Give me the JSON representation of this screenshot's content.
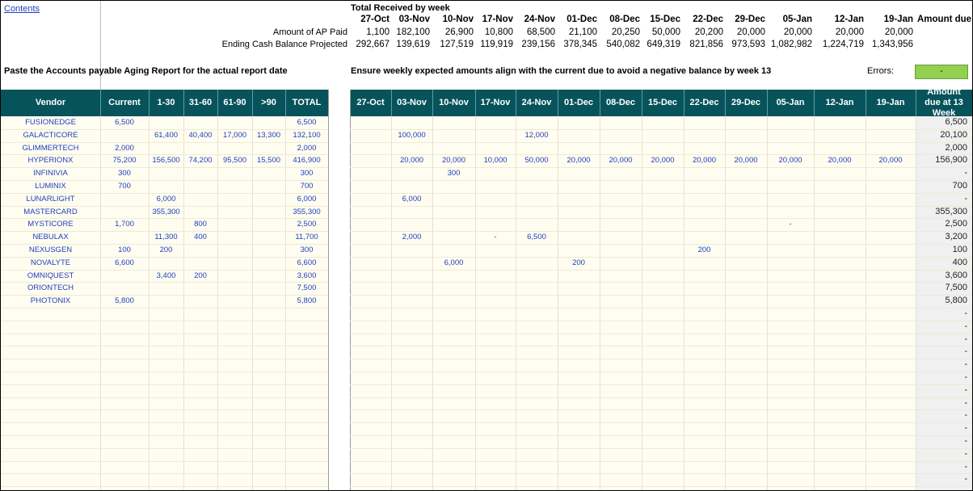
{
  "sheet": {
    "contents_link": "Contents",
    "top_title": "Total Received by week",
    "weeks": [
      "27-Oct",
      "03-Nov",
      "10-Nov",
      "17-Nov",
      "24-Nov",
      "01-Dec",
      "08-Dec",
      "15-Dec",
      "22-Dec",
      "29-Dec",
      "05-Jan",
      "12-Jan",
      "19-Jan"
    ],
    "amount_due_top": "Amount due a",
    "ap_paid_label": "Amount of AP Paid",
    "ap_paid": [
      "1,100",
      "182,100",
      "26,900",
      "10,800",
      "68,500",
      "21,100",
      "20,250",
      "50,000",
      "20,200",
      "20,000",
      "20,000",
      "20,000",
      "20,000"
    ],
    "cash_label": "Ending Cash Balance Projected",
    "cash": [
      "292,667",
      "139,619",
      "127,519",
      "119,919",
      "239,156",
      "378,345",
      "540,082",
      "649,319",
      "821,856",
      "973,593",
      "1,082,982",
      "1,224,719",
      "1,343,956"
    ],
    "instruction_left": "Paste the Accounts payable Aging Report for the actual report date",
    "instruction_right": "Ensure weekly expected amounts align with the current due to avoid a negative balance by week 13",
    "errors_label": "Errors:",
    "errors_value": "-",
    "aging_headers": [
      "Vendor",
      "Current",
      "1-30",
      "31-60",
      "61-90",
      ">90",
      "TOTAL"
    ],
    "due_header": "Amount due at  13 Week",
    "vendors": [
      {
        "name": "FUSIONEDGE",
        "aging": [
          "6,500",
          "",
          "",
          "",
          "",
          "6,500"
        ],
        "weekly": [
          "",
          "",
          "",
          "",
          "",
          "",
          "",
          "",
          "",
          "",
          "",
          "",
          ""
        ],
        "due": "6,500"
      },
      {
        "name": "GALACTICORE",
        "aging": [
          "",
          "61,400",
          "40,400",
          "17,000",
          "13,300",
          "132,100"
        ],
        "weekly": [
          "",
          "100,000",
          "",
          "",
          "12,000",
          "",
          "",
          "",
          "",
          "",
          "",
          "",
          ""
        ],
        "due": "20,100"
      },
      {
        "name": "GLIMMERTECH",
        "aging": [
          "2,000",
          "",
          "",
          "",
          "",
          "2,000"
        ],
        "weekly": [
          "",
          "",
          "",
          "",
          "",
          "",
          "",
          "",
          "",
          "",
          "",
          "",
          ""
        ],
        "due": "2,000"
      },
      {
        "name": "HYPERIONX",
        "aging": [
          "75,200",
          "156,500",
          "74,200",
          "95,500",
          "15,500",
          "416,900"
        ],
        "weekly": [
          "",
          "20,000",
          "20,000",
          "10,000",
          "50,000",
          "20,000",
          "20,000",
          "20,000",
          "20,000",
          "20,000",
          "20,000",
          "20,000",
          "20,000"
        ],
        "due": "156,900"
      },
      {
        "name": "INFINIVIA",
        "aging": [
          "300",
          "",
          "",
          "",
          "",
          "300"
        ],
        "weekly": [
          "",
          "",
          "300",
          "",
          "",
          "",
          "",
          "",
          "",
          "",
          "",
          "",
          ""
        ],
        "due": "-"
      },
      {
        "name": "LUMINIX",
        "aging": [
          "700",
          "",
          "",
          "",
          "",
          "700"
        ],
        "weekly": [
          "",
          "",
          "",
          "",
          "",
          "",
          "",
          "",
          "",
          "",
          "",
          "",
          ""
        ],
        "due": "700"
      },
      {
        "name": "LUNARLIGHT",
        "aging": [
          "",
          "6,000",
          "",
          "",
          "",
          "6,000"
        ],
        "weekly": [
          "",
          "6,000",
          "",
          "",
          "",
          "",
          "",
          "",
          "",
          "",
          "",
          "",
          ""
        ],
        "due": "-"
      },
      {
        "name": "MASTERCARD",
        "aging": [
          "",
          "355,300",
          "",
          "",
          "",
          "355,300"
        ],
        "weekly": [
          "",
          "",
          "",
          "",
          "",
          "",
          "",
          "",
          "",
          "",
          "",
          "",
          ""
        ],
        "due": "355,300"
      },
      {
        "name": "MYSTICORE",
        "aging": [
          "1,700",
          "",
          "800",
          "",
          "",
          "2,500"
        ],
        "weekly": [
          "",
          "",
          "",
          "",
          "",
          "",
          "",
          "",
          "",
          "",
          "-",
          "",
          ""
        ],
        "due": "2,500"
      },
      {
        "name": "NEBULAX",
        "aging": [
          "",
          "11,300",
          "400",
          "",
          "",
          "11,700"
        ],
        "weekly": [
          "",
          "2,000",
          "",
          "-",
          "6,500",
          "",
          "",
          "",
          "",
          "",
          "",
          "",
          ""
        ],
        "due": "3,200"
      },
      {
        "name": "NEXUSGEN",
        "aging": [
          "100",
          "200",
          "",
          "",
          "",
          "300"
        ],
        "weekly": [
          "",
          "",
          "",
          "",
          "",
          "",
          "",
          "",
          "200",
          "",
          "",
          "",
          ""
        ],
        "due": "100"
      },
      {
        "name": "NOVALYTE",
        "aging": [
          "6,600",
          "",
          "",
          "",
          "",
          "6,600"
        ],
        "weekly": [
          "",
          "",
          "6,000",
          "",
          "",
          "200",
          "",
          "",
          "",
          "",
          "",
          "",
          ""
        ],
        "due": "400"
      },
      {
        "name": "OMNIQUEST",
        "aging": [
          "",
          "3,400",
          "200",
          "",
          "",
          "3,600"
        ],
        "weekly": [
          "",
          "",
          "",
          "",
          "",
          "",
          "",
          "",
          "",
          "",
          "",
          "",
          ""
        ],
        "due": "3,600"
      },
      {
        "name": "ORIONTECH",
        "aging": [
          "",
          "",
          "",
          "",
          "",
          "7,500"
        ],
        "weekly": [
          "",
          "",
          "",
          "",
          "",
          "",
          "",
          "",
          "",
          "",
          "",
          "",
          ""
        ],
        "due": "7,500"
      },
      {
        "name": "PHOTONIX",
        "aging": [
          "5,800",
          "",
          "",
          "",
          "",
          "5,800"
        ],
        "weekly": [
          "",
          "",
          "",
          "",
          "",
          "",
          "",
          "",
          "",
          "",
          "",
          "",
          ""
        ],
        "due": "5,800"
      }
    ],
    "empty_due": [
      "-",
      "-",
      "-",
      "-",
      "-",
      "-",
      "-",
      "-",
      "-",
      "-",
      "-",
      "-",
      "-",
      "-",
      "-"
    ],
    "colors": {
      "header_band": "#07535b",
      "body_fill": "#fffdf0",
      "errors_fill": "#92d050",
      "vendor_text": "#1f3fbf"
    }
  }
}
